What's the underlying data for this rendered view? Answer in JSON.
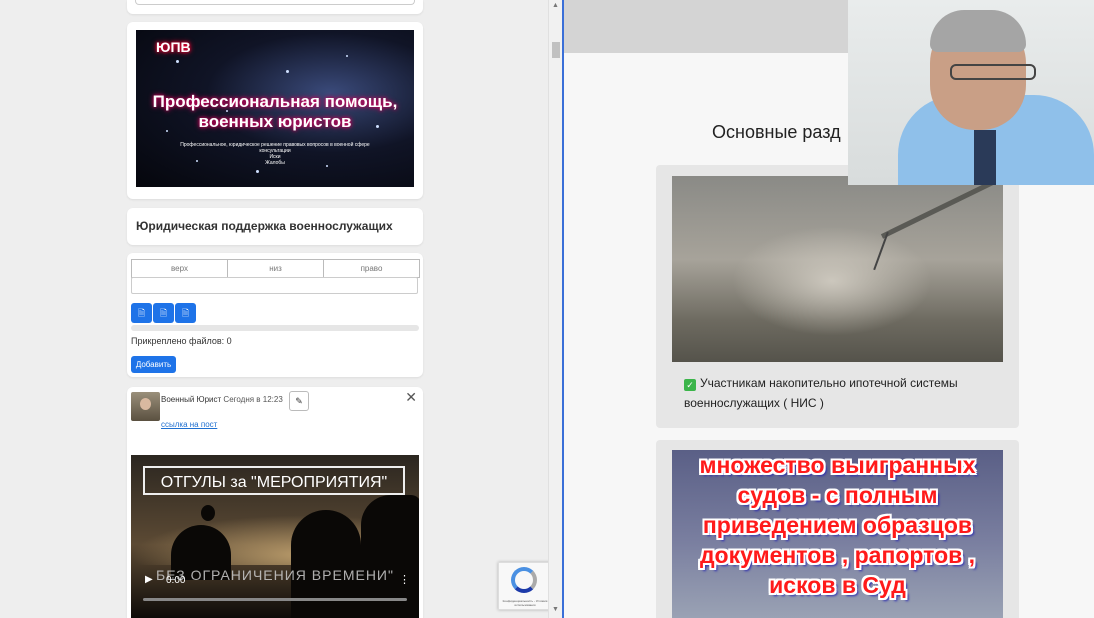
{
  "left": {
    "banner": {
      "tag": "ЮПВ",
      "title_line1": "Профессиональная помощь,",
      "title_line2": "военных юристов",
      "small_text": "Профессиональное, юридическое решение правовых вопросов в военной сфере",
      "small_items": [
        "консультации",
        "Иски",
        "Жалобы"
      ]
    },
    "section_title": "Юридическая поддержка военнослужащих",
    "form": {
      "tabs": [
        "верх",
        "низ",
        "право"
      ],
      "text_value": "",
      "file_buttons": [
        "file-icon",
        "file-icon",
        "file-icon"
      ],
      "upload_progress": 0,
      "attached_label": "Прикреплено файлов: 0",
      "add_button": "Добавить"
    },
    "post": {
      "author": "Военный Юрист",
      "time": "Сегодня в 12:23",
      "link_text": "ссылка на пост",
      "video": {
        "title_overlay": "ОТГУЛЫ за \"МЕРОПРИЯТИЯ\"",
        "bottom_overlay": "БЕЗ ОГРАНИЧЕНИЯ ВРЕМЕНИ\"",
        "time": "0:00"
      }
    },
    "recaptcha_text": "Конфиденциальность - Условия использования"
  },
  "right": {
    "section_title": "Основные разд",
    "cards": [
      {
        "text": "Участникам накопительно ипотечной системы военнослужащих ( НИС )"
      },
      {
        "image_text": "множество выигранных судов - с полным приведением образцов документов , рапортов , исков в Суд"
      }
    ]
  },
  "colors": {
    "accent": "#1e73e8",
    "link": "#1e6fd0",
    "divider": "#3a6fd8"
  }
}
